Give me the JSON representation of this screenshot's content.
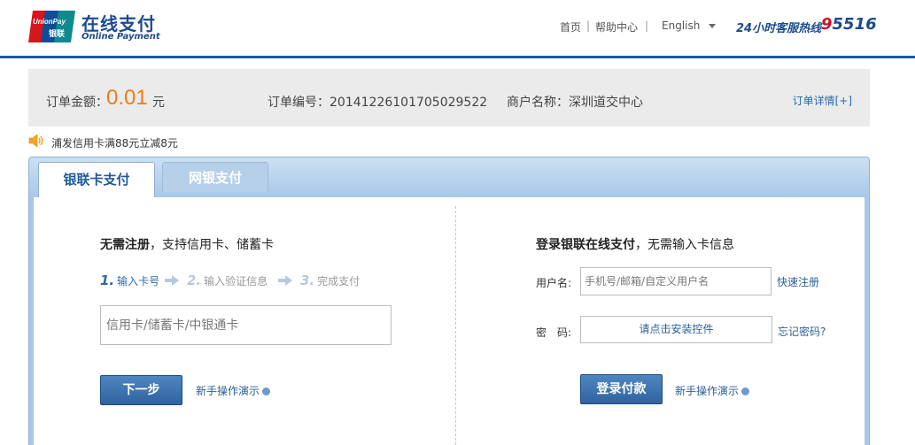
{
  "header": {
    "logo_text": "UnionPay 银联",
    "title": "在线支付",
    "subtitle": "Online Payment",
    "nav": {
      "home": "首页",
      "help": "帮助中心",
      "separator": "|",
      "language": "English"
    },
    "hotline_label": "24小时客服热线",
    "hotline_prefix": "9",
    "hotline_rest": "5516"
  },
  "order": {
    "amount_label": "订单金额：",
    "amount": "0.01",
    "unit": "元",
    "number_label": "订单编号：",
    "number": "20141226101705029522",
    "merchant_label": "商户名称：",
    "merchant": "深圳道交中心",
    "details_link": "订单详情[+]"
  },
  "promo": {
    "text": "浦发信用卡满88元立减8元"
  },
  "tabs": [
    {
      "label": "银联卡支付",
      "active": true
    },
    {
      "label": "网银支付",
      "active": false
    }
  ],
  "left": {
    "heading_bold": "无需注册",
    "heading_rest": "，支持信用卡、储蓄卡",
    "steps": [
      {
        "num": "1.",
        "label": "输入卡号"
      },
      {
        "num": "2.",
        "label": "输入验证信息"
      },
      {
        "num": "3.",
        "label": "完成支付"
      }
    ],
    "card_placeholder": "信用卡/储蓄卡/中银通卡",
    "next_button": "下一步",
    "demo_link": "新手操作演示"
  },
  "right": {
    "heading_bold": "登录银联在线支付",
    "heading_rest": "，无需输入卡信息",
    "username_label": "用户名:",
    "username_placeholder": "手机号/邮箱/自定义用户名",
    "register_link": "快速注册",
    "password_label": "密　码:",
    "password_control": "请点击安装控件",
    "forgot_link": "忘记密码?",
    "login_button": "登录付款",
    "demo_link": "新手操作演示"
  },
  "colors": {
    "brand_blue": "#1a4c8c",
    "accent_orange": "#f07b12",
    "hotline_red": "#c8102e",
    "link_blue": "#2b5f94"
  }
}
